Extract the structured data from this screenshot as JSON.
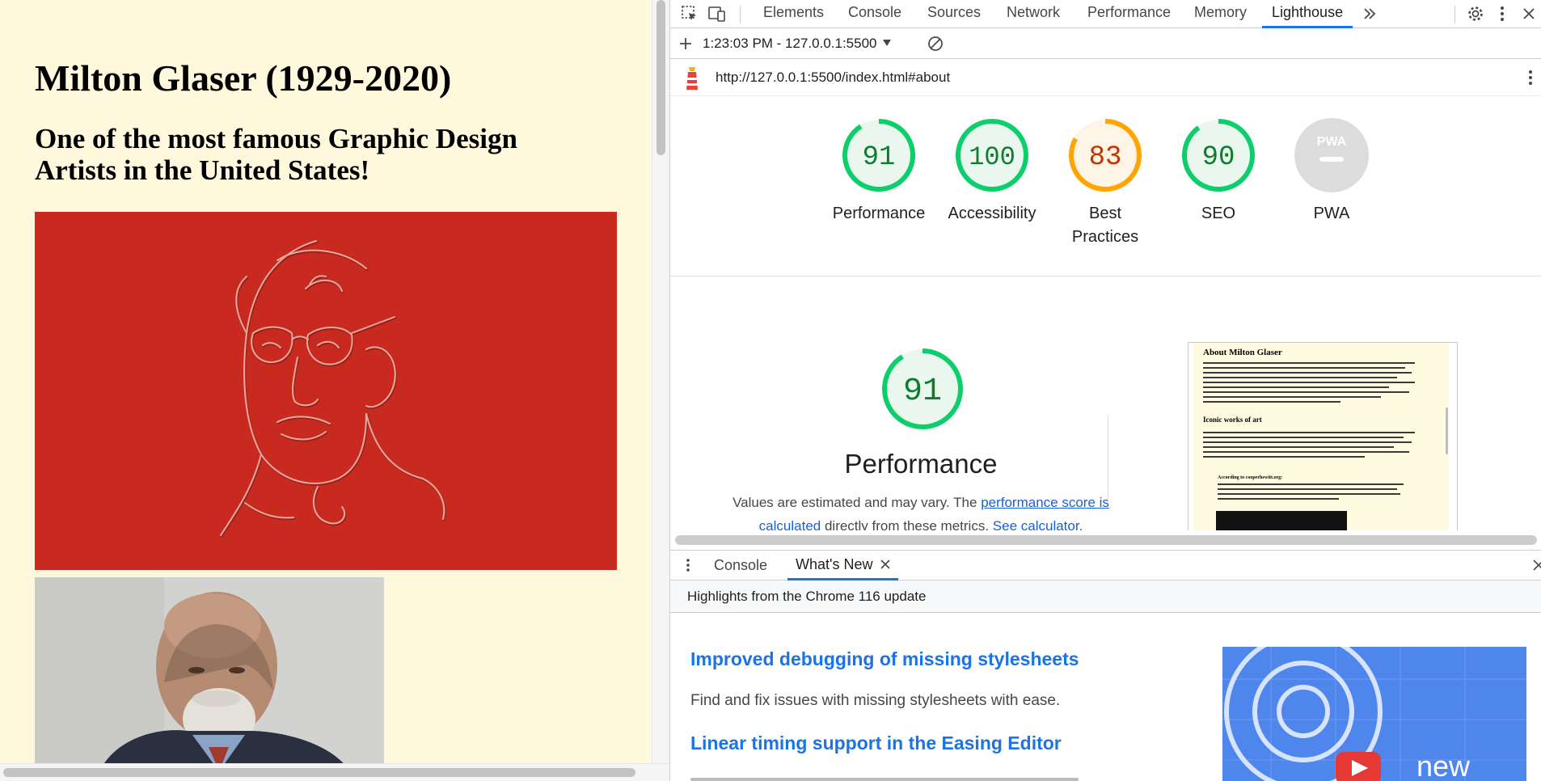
{
  "page": {
    "title": "Milton Glaser (1929-2020)",
    "subtitle": "One of the most famous Graphic Design Artists in the United States!"
  },
  "devtools": {
    "tabs": [
      "Elements",
      "Console",
      "Sources",
      "Network",
      "Performance",
      "Memory",
      "Lighthouse"
    ],
    "active_tab": "Lighthouse",
    "more_tabs_icon": "double-chevron-right-icon",
    "report_selector": "1:23:03 PM - 127.0.0.1:5500",
    "url": "http://127.0.0.1:5500/index.html#about",
    "scores": [
      {
        "name": "Performance",
        "score": 91,
        "status": "pass"
      },
      {
        "name": "Accessibility",
        "score": 100,
        "status": "pass"
      },
      {
        "name": "Best Practices",
        "score": 83,
        "status": "average"
      },
      {
        "name": "SEO",
        "score": 90,
        "status": "pass"
      },
      {
        "name": "PWA",
        "score": null,
        "status": "na",
        "badge": "PWA"
      }
    ],
    "performance": {
      "score": 91,
      "title": "Performance",
      "desc_prefix": "Values are estimated and may vary. The ",
      "desc_link1": "performance score is calculated",
      "desc_middle": " directly from these metrics. ",
      "desc_link2": "See calculator."
    },
    "screenshot_preview": {
      "heading": "About Milton Glaser",
      "subheading": "Iconic works of art",
      "quote_label": "According to cooperhewitt.org:"
    },
    "colors": {
      "pass": "#0c7d2e",
      "pass_ring": "#0cce6b",
      "average": "#c33300",
      "average_ring": "#ffa400",
      "accent": "#1a73e8"
    },
    "drawer": {
      "tabs": [
        "Console",
        "What's New"
      ],
      "active_tab": "What's New",
      "header": "Highlights from the Chrome 116 update",
      "items": [
        {
          "title": "Improved debugging of missing stylesheets",
          "desc": "Find and fix issues with missing stylesheets with ease."
        },
        {
          "title": "Linear timing support in the Easing Editor"
        }
      ],
      "promo_text": "new"
    }
  }
}
